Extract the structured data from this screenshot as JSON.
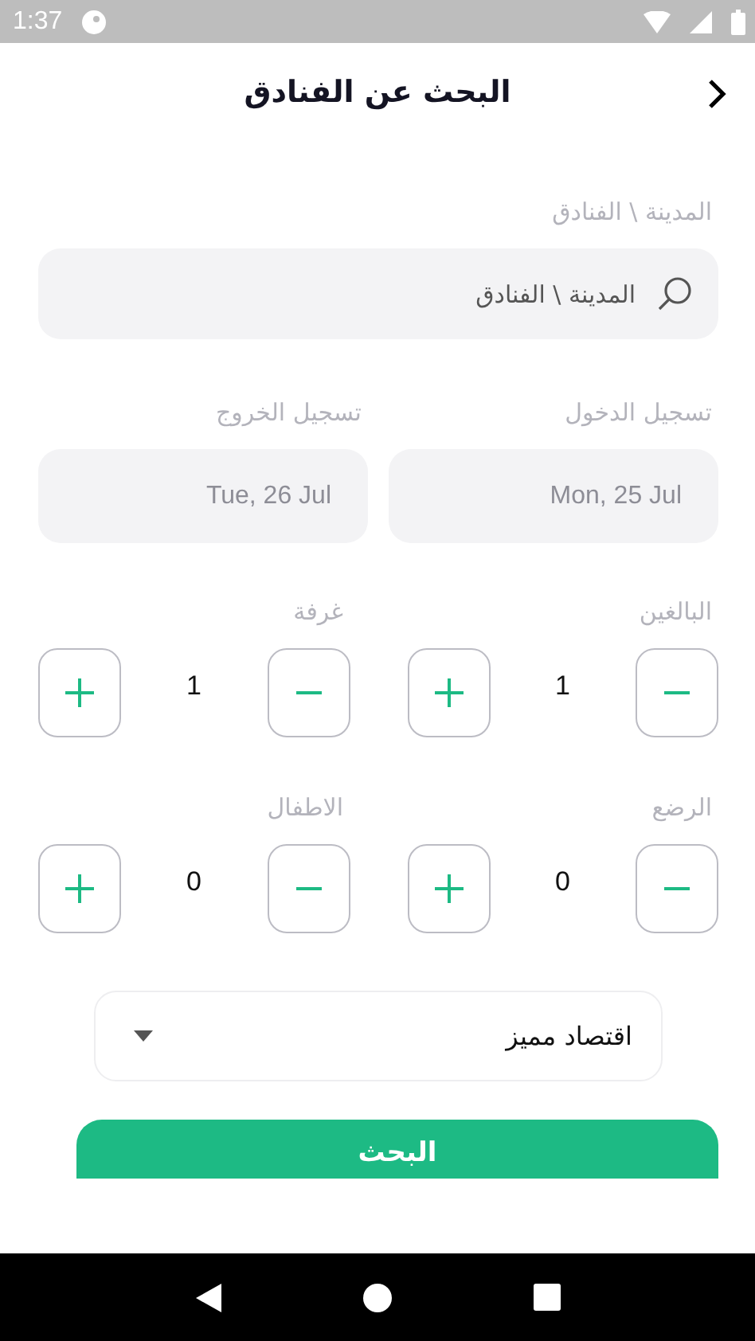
{
  "status_bar": {
    "time": "1:37"
  },
  "header": {
    "title": "البحث عن الفنادق"
  },
  "destination": {
    "label": "المدينة \\ الفنادق",
    "placeholder": "المدينة \\ الفنادق"
  },
  "dates": [
    {
      "label": "تسجيل الدخول",
      "value": "Mon, 25 Jul"
    },
    {
      "label": "تسجيل الخروج",
      "value": "Tue, 26 Jul"
    }
  ],
  "counters": [
    {
      "label": "البالغين",
      "value": "1"
    },
    {
      "label": "غرفة",
      "value": "1"
    },
    {
      "label": "الرضع",
      "value": "0"
    },
    {
      "label": "الاطفال",
      "value": "0"
    }
  ],
  "cabin_class": {
    "value": "اقتصاد مميز"
  },
  "search_button": {
    "label": "البحث"
  }
}
